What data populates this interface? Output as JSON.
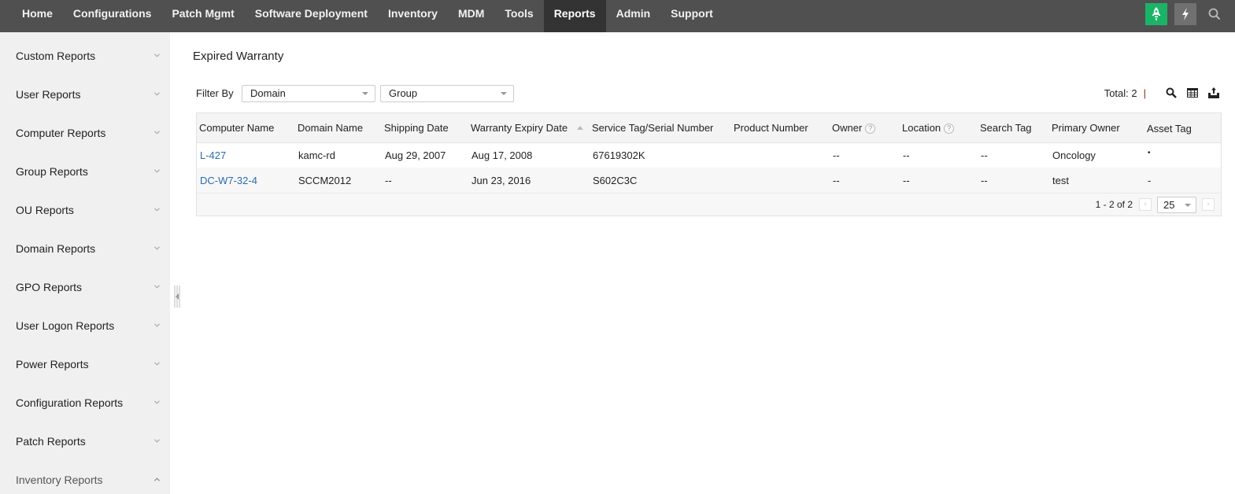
{
  "topnav": {
    "tabs": [
      {
        "label": "Home"
      },
      {
        "label": "Configurations"
      },
      {
        "label": "Patch Mgmt"
      },
      {
        "label": "Software Deployment"
      },
      {
        "label": "Inventory"
      },
      {
        "label": "MDM"
      },
      {
        "label": "Tools"
      },
      {
        "label": "Reports",
        "active": true
      },
      {
        "label": "Admin"
      },
      {
        "label": "Support"
      }
    ],
    "icons": [
      "rocket-icon",
      "lightning-icon",
      "search-icon"
    ],
    "accent_color": "#1bb467"
  },
  "sidebar": {
    "items": [
      {
        "label": "Custom Reports",
        "expanded": false
      },
      {
        "label": "User Reports",
        "expanded": false
      },
      {
        "label": "Computer Reports",
        "expanded": false
      },
      {
        "label": "Group Reports",
        "expanded": false
      },
      {
        "label": "OU Reports",
        "expanded": false
      },
      {
        "label": "Domain Reports",
        "expanded": false
      },
      {
        "label": "GPO Reports",
        "expanded": false
      },
      {
        "label": "User Logon Reports",
        "expanded": false
      },
      {
        "label": "Power Reports",
        "expanded": false
      },
      {
        "label": "Configuration Reports",
        "expanded": false
      },
      {
        "label": "Patch Reports",
        "expanded": false
      },
      {
        "label": "Inventory Reports",
        "expanded": true
      }
    ]
  },
  "main": {
    "title": "Expired Warranty",
    "filter": {
      "label": "Filter By",
      "domain_value": "Domain",
      "group_value": "Group"
    },
    "toolbar": {
      "total": "Total: 2",
      "separator": "|"
    },
    "table": {
      "columns": [
        {
          "label": "Computer Name"
        },
        {
          "label": "Domain Name"
        },
        {
          "label": "Shipping Date"
        },
        {
          "label": "Warranty Expiry Date",
          "sorted": "asc"
        },
        {
          "label": "Service Tag/Serial Number"
        },
        {
          "label": "Product Number"
        },
        {
          "label": "Owner",
          "help": "?"
        },
        {
          "label": "Location",
          "help": "?"
        },
        {
          "label": "Search Tag"
        },
        {
          "label": "Primary Owner"
        },
        {
          "label": "Asset Tag"
        }
      ],
      "rows": [
        [
          "L-427",
          "kamc-rd",
          "Aug 29, 2007",
          "Aug 17, 2008",
          "67619302K",
          "",
          "--",
          "--",
          "--",
          "Oncology",
          "•"
        ],
        [
          "DC-W7-32-4",
          "SCCM2012",
          "--",
          "Jun 23, 2016",
          "S602C3C",
          "",
          "--",
          "--",
          "--",
          "test",
          "-"
        ]
      ]
    },
    "pager": {
      "range": "1 - 2 of 2",
      "page_size": "25",
      "prev": "‹",
      "next": "›"
    }
  }
}
